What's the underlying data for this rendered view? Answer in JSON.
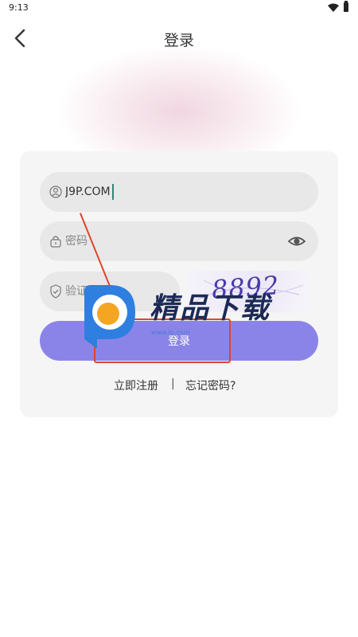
{
  "status_bar": {
    "time": "9:13"
  },
  "header": {
    "title": "登录"
  },
  "form": {
    "username": {
      "value": "J9P.COM",
      "placeholder": ""
    },
    "password": {
      "value": "",
      "placeholder": "密码"
    },
    "captcha_input": {
      "value": "",
      "placeholder": "验证码"
    },
    "captcha_image_text": "8892",
    "login_label": "登录"
  },
  "links": {
    "register": "立即注册",
    "separator": "|",
    "forgot": "忘记密码?"
  },
  "watermark": {
    "text": "精品下载",
    "url": "www.jp.com"
  },
  "colors": {
    "primary_button": "#8b84e8",
    "card_bg": "#f5f5f5",
    "field_bg": "#e8e8e8",
    "watermark_red": "#e0442c"
  }
}
